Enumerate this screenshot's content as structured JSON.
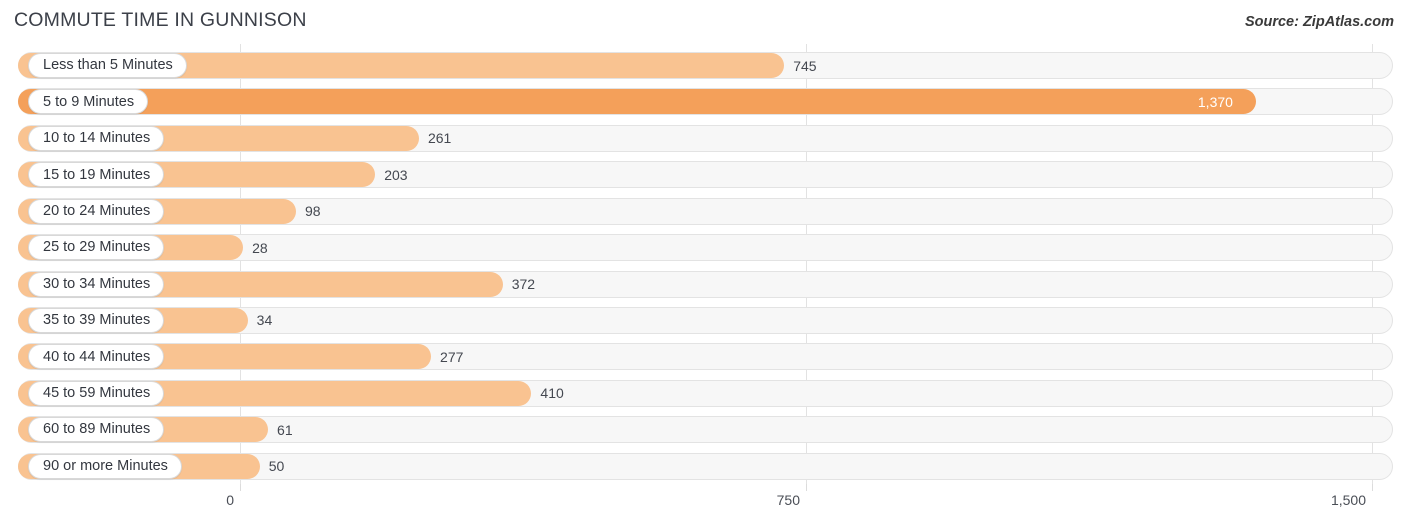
{
  "header": {
    "title": "COMMUTE TIME IN GUNNISON",
    "source": "Source: ZipAtlas.com"
  },
  "colors": {
    "bar": "#f9c391",
    "bar_accent": "#f4a05a",
    "track": "#f7f7f7",
    "gridline": "#e2e2e2",
    "value_text": "#444850",
    "value_text_inside": "#ffffff",
    "title_text": "#3c4049"
  },
  "axis": {
    "ticks": [
      {
        "label": "0",
        "value": 0
      },
      {
        "label": "750",
        "value": 750
      },
      {
        "label": "1,500",
        "value": 1500
      }
    ]
  },
  "chart_data": {
    "type": "bar",
    "orientation": "horizontal",
    "title": "COMMUTE TIME IN GUNNISON",
    "xlabel": "",
    "ylabel": "",
    "xlim": [
      0,
      1500
    ],
    "grid": true,
    "legend": false,
    "categories": [
      "Less than 5 Minutes",
      "5 to 9 Minutes",
      "10 to 14 Minutes",
      "15 to 19 Minutes",
      "20 to 24 Minutes",
      "25 to 29 Minutes",
      "30 to 34 Minutes",
      "35 to 39 Minutes",
      "40 to 44 Minutes",
      "45 to 59 Minutes",
      "60 to 89 Minutes",
      "90 or more Minutes"
    ],
    "values": [
      745,
      1370,
      261,
      203,
      98,
      28,
      372,
      34,
      277,
      410,
      61,
      50
    ],
    "value_labels": [
      "745",
      "1,370",
      "261",
      "203",
      "98",
      "28",
      "372",
      "34",
      "277",
      "410",
      "61",
      "50"
    ],
    "highlight_index": 1
  }
}
